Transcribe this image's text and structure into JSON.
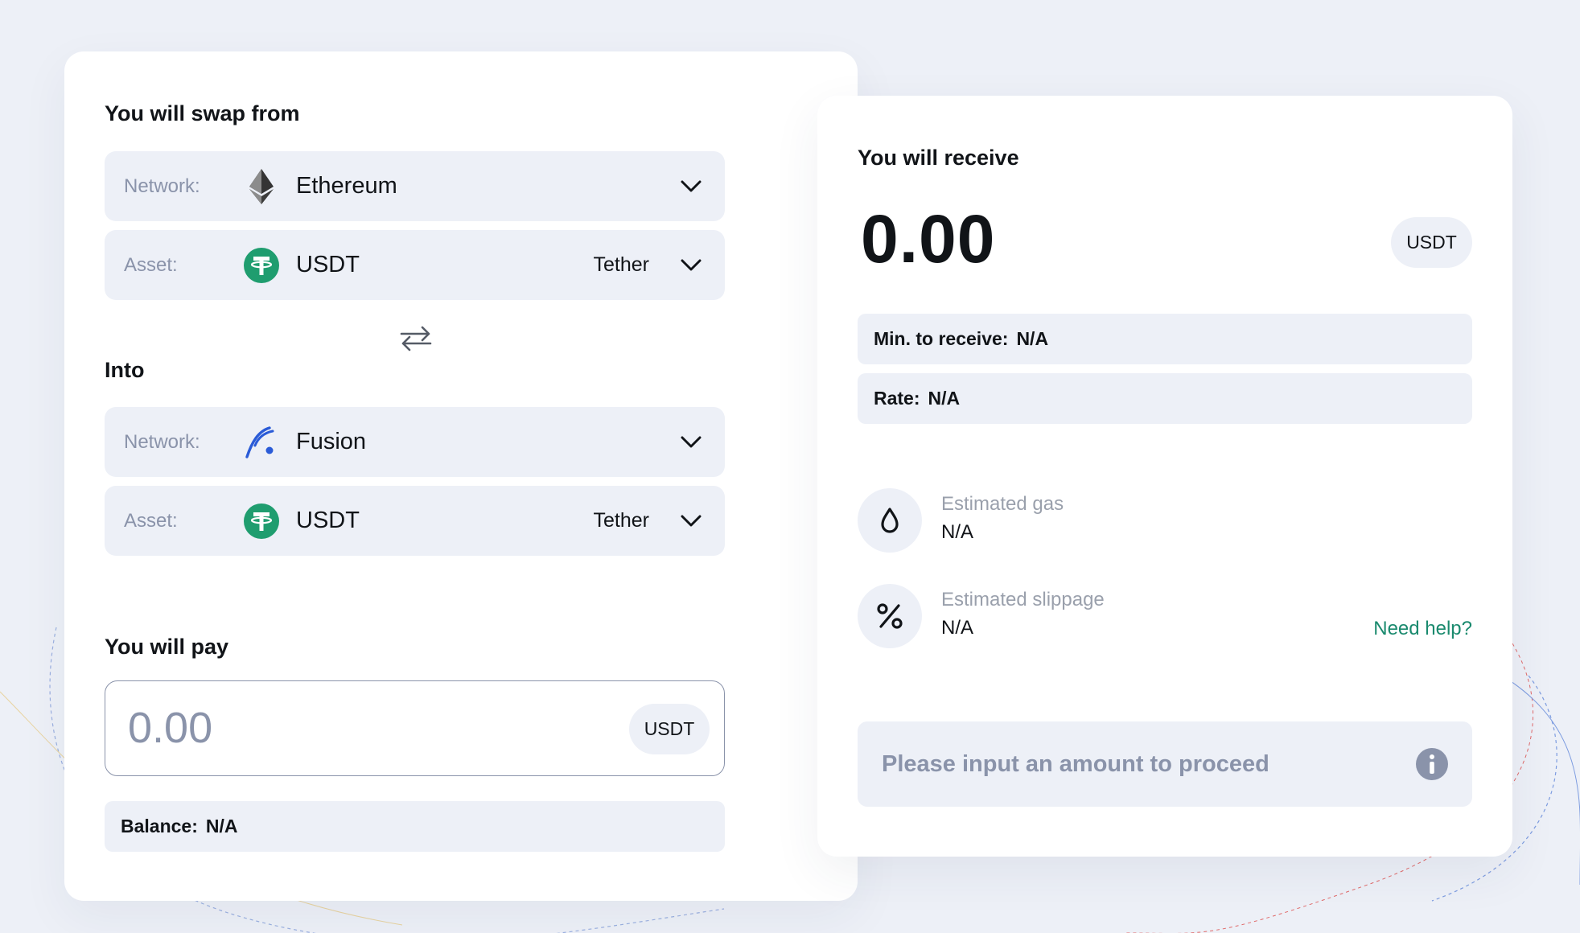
{
  "from": {
    "title": "You will swap from",
    "network": {
      "label": "Network:",
      "value": "Ethereum",
      "icon": "ethereum-icon"
    },
    "asset": {
      "label": "Asset:",
      "value": "USDT",
      "name": "Tether",
      "icon": "tether-icon"
    }
  },
  "into": {
    "title": "Into",
    "network": {
      "label": "Network:",
      "value": "Fusion",
      "icon": "fusion-icon"
    },
    "asset": {
      "label": "Asset:",
      "value": "USDT",
      "name": "Tether",
      "icon": "tether-icon"
    }
  },
  "pay": {
    "title": "You will pay",
    "placeholder": "0.00",
    "token": "USDT",
    "balance_label": "Balance:",
    "balance_value": "N/A"
  },
  "receive": {
    "title": "You will receive",
    "amount": "0.00",
    "token": "USDT",
    "min_label": "Min. to receive:",
    "min_value": "N/A",
    "rate_label": "Rate:",
    "rate_value": "N/A",
    "gas_label": "Estimated gas",
    "gas_value": "N/A",
    "slippage_label": "Estimated slippage",
    "slippage_value": "N/A",
    "help_link": "Need help?",
    "proceed_text": "Please input an amount to proceed"
  },
  "colors": {
    "background": "#edf0f7",
    "card": "#ffffff",
    "muted": "#8a93aa",
    "tether": "#1f9d6f",
    "fusion": "#2a5bd7",
    "link": "#1a8a6e"
  }
}
